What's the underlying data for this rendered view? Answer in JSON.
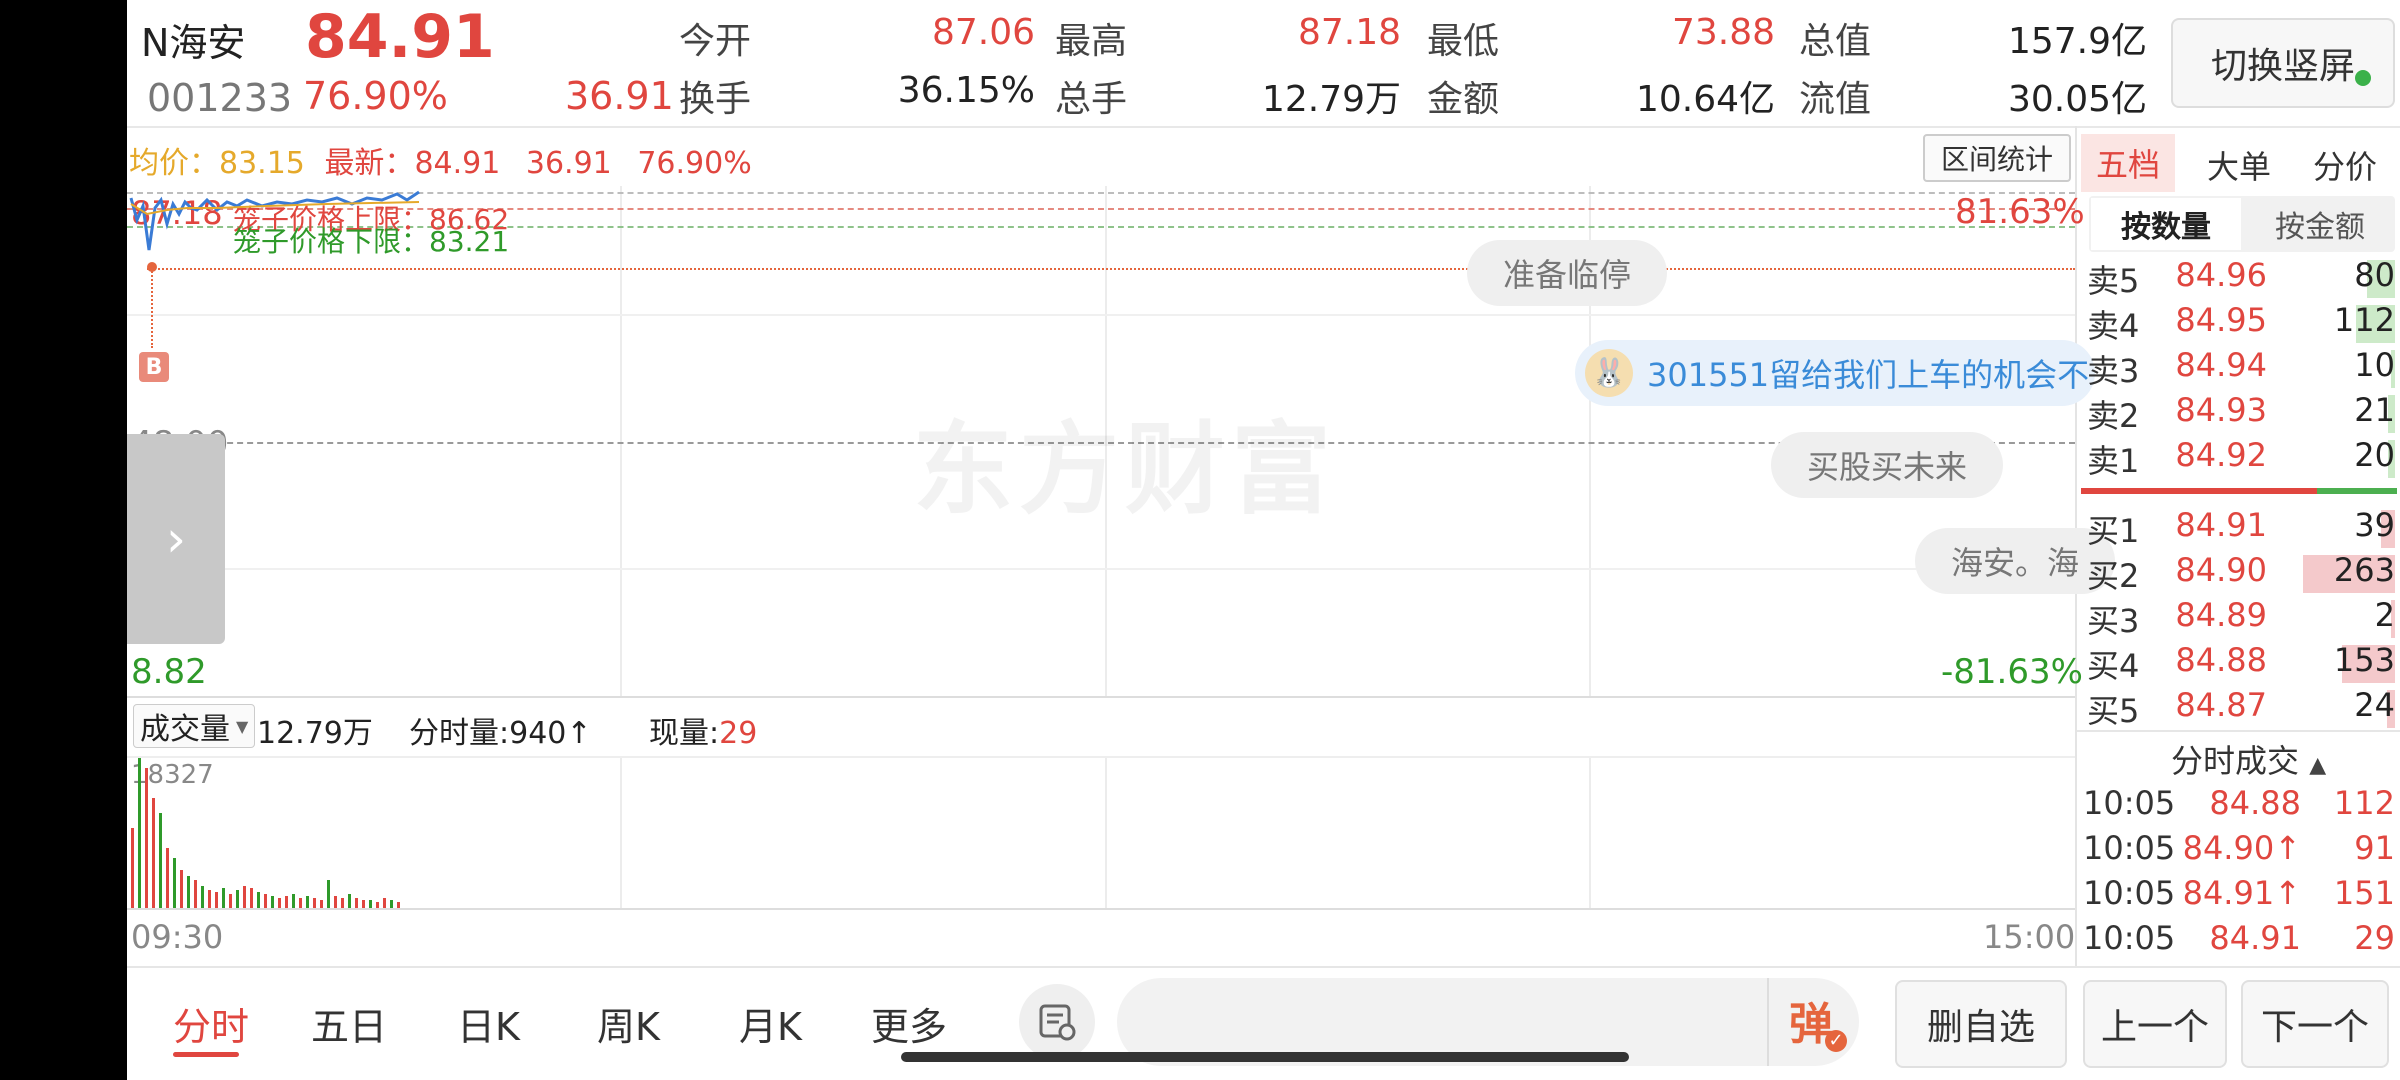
{
  "header": {
    "name": "N海安",
    "price": "84.91",
    "code": "001233",
    "pct": "76.90%",
    "change": "36.91",
    "quotes_row1": [
      {
        "label": "今开",
        "value": "87.06",
        "color": "#e0463f"
      },
      {
        "label": "最高",
        "value": "87.18",
        "color": "#e0463f"
      },
      {
        "label": "最低",
        "value": "73.88",
        "color": "#e0463f"
      },
      {
        "label": "总值",
        "value": "157.9亿",
        "color": "#222222"
      }
    ],
    "quotes_row2": [
      {
        "label": "换手",
        "value": "36.15%",
        "color": "#222222"
      },
      {
        "label": "总手",
        "value": "12.79万",
        "color": "#222222"
      },
      {
        "label": "金额",
        "value": "10.64亿",
        "color": "#222222"
      },
      {
        "label": "流值",
        "value": "30.05亿",
        "color": "#222222"
      }
    ],
    "switch_label": "切换竖屏"
  },
  "chart": {
    "avg_label": "均价：",
    "avg_value": "83.15",
    "latest_label": "最新：",
    "latest_value": "84.91",
    "latest_change": "36.91",
    "latest_pct": "76.90%",
    "range_btn": "区间统计",
    "y_top": "87.18",
    "y_mid": "48.00",
    "y_bottom": "8.82",
    "pct_top": "81.63%",
    "pct_bottom": "-81.63%",
    "cage_upper_label": "笼子价格上限：86.62",
    "cage_lower_label": "笼子价格下限：83.21",
    "b_marker": "B",
    "watermark": "东方财富",
    "bubbles": [
      "准备临停",
      "301551留给我们上车的机会不",
      "买股买未来",
      "海安。海"
    ],
    "volume_label": "成交量",
    "volume_total": "12.79万",
    "tick_volume": "分时量:940↑",
    "current_volume_label": "现量:",
    "current_volume": "29",
    "volume_max": "18327",
    "time_start": "09:30",
    "time_end": "15:00",
    "colors": {
      "up": "#e0463f",
      "down": "#2f9a2a",
      "price_line": "#3a7bd5"
    }
  },
  "orderbook": {
    "tabs": [
      "五档",
      "大单",
      "分价"
    ],
    "subtabs": [
      "按数量",
      "按金额"
    ],
    "sell": [
      {
        "label": "卖5",
        "price": "84.96",
        "vol": "80",
        "bar": 0.3
      },
      {
        "label": "卖4",
        "price": "84.95",
        "vol": "112",
        "bar": 0.42
      },
      {
        "label": "卖3",
        "price": "84.94",
        "vol": "10",
        "bar": 0.04
      },
      {
        "label": "卖2",
        "price": "84.93",
        "vol": "21",
        "bar": 0.08
      },
      {
        "label": "卖1",
        "price": "84.92",
        "vol": "20",
        "bar": 0.08
      }
    ],
    "buy": [
      {
        "label": "买1",
        "price": "84.91",
        "vol": "39",
        "bar": 0.15
      },
      {
        "label": "买2",
        "price": "84.90",
        "vol": "263",
        "bar": 1.0
      },
      {
        "label": "买3",
        "price": "84.89",
        "vol": "2",
        "bar": 0.01
      },
      {
        "label": "买4",
        "price": "84.88",
        "vol": "153",
        "bar": 0.58
      },
      {
        "label": "买5",
        "price": "84.87",
        "vol": "24",
        "bar": 0.09
      }
    ],
    "ticks_title": "分时成交",
    "ticks": [
      {
        "time": "10:05",
        "price": "84.88",
        "vol": "112",
        "vol_color": "#e0463f"
      },
      {
        "time": "10:05",
        "price": "84.90↑",
        "vol": "91",
        "vol_color": "#e0463f"
      },
      {
        "time": "10:05",
        "price": "84.91↑",
        "vol": "151",
        "vol_color": "#e0463f"
      },
      {
        "time": "10:05",
        "price": "84.91",
        "vol": "29",
        "vol_color": "#e0463f"
      }
    ]
  },
  "bottom": {
    "tabs": [
      "分时",
      "五日",
      "日K",
      "周K",
      "月K",
      "更多"
    ],
    "danmu_label": "弹",
    "buttons": [
      "删自选",
      "上一个",
      "下一个"
    ]
  }
}
